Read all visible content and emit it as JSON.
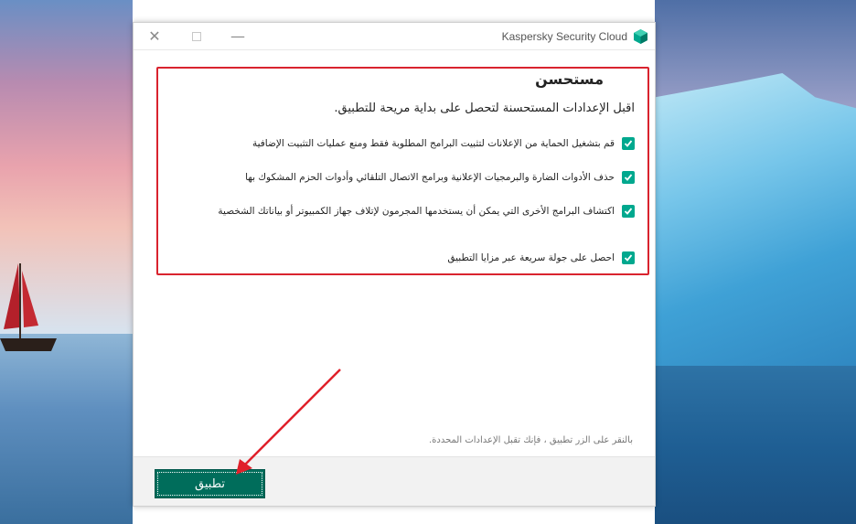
{
  "window": {
    "title": "Kaspersky Security Cloud",
    "controls": {
      "close_icon": "close-icon",
      "maximize_icon": "maximize-icon",
      "minimize_icon": "minimize-icon"
    }
  },
  "dialog": {
    "heading": "مستحسن",
    "subtitle": "اقبل الإعدادات المستحسنة لتحصل على بداية مريحة للتطبيق.",
    "options": [
      {
        "label": "قم بتشغيل الحماية من الإعلانات لتثبيت البرامج المطلوبة فقط ومنع عمليات التثبيت الإضافية",
        "checked": true
      },
      {
        "label": "حذف الأدوات الضارة والبرمجيات الإعلانية وبرامج الاتصال التلقائي وأدوات الحزم المشكوك بها",
        "checked": true
      },
      {
        "label": "اكتشاف البرامج الأخرى التي يمكن أن يستخدمها المجرمون لإتلاف جهاز الكمبيوتر أو بياناتك الشخصية",
        "checked": true
      },
      {
        "label": "احصل على جولة سريعة عبر مزايا التطبيق",
        "checked": true
      }
    ],
    "footnote": "بالنقر على الزر تطبيق ، فإنك تقبل الإعدادات المحددة.",
    "apply_label": "تطبيق"
  },
  "colors": {
    "accent": "#00a88e",
    "button": "#006d5b",
    "highlight": "#d9232e"
  }
}
